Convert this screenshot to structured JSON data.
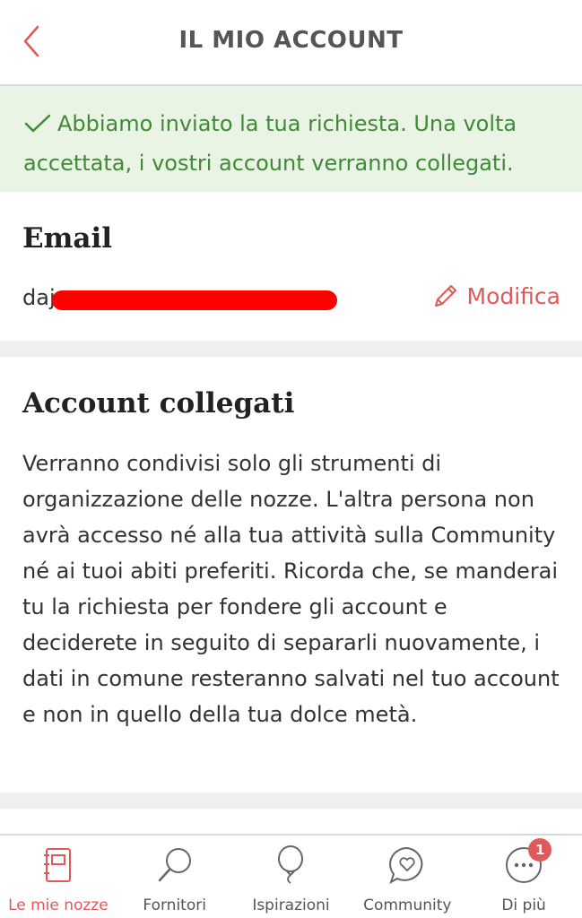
{
  "header": {
    "title": "IL MIO ACCOUNT",
    "back_icon": "chevron-left-icon"
  },
  "notice": {
    "text": "Abbiamo inviato la tua richiesta. Una volta accettata, i vostri account verranno collegati.",
    "icon": "check-icon",
    "color": "#3f8a35"
  },
  "email_section": {
    "title": "Email",
    "value_visible": "daj",
    "edit_label": "Modifica"
  },
  "linked_section": {
    "title": "Account collegati",
    "description": "Verranno condivisi solo gli strumenti di organizzazione delle nozze. L'altra persona non avrà accesso né alla tua attività sulla Community né ai tuoi abiti preferiti. Ricorda che, se manderai tu la richiesta per fondere gli account e deciderete in seguito di separarli nuovamente, i dati in comune resteranno salvati nel tuo account e non in quello della tua dolce metà."
  },
  "tabbar": {
    "tabs": [
      {
        "label": "Le mie nozze",
        "icon": "notebook-icon",
        "active": true
      },
      {
        "label": "Fornitori",
        "icon": "search-icon",
        "active": false
      },
      {
        "label": "Ispirazioni",
        "icon": "balloon-icon",
        "active": false
      },
      {
        "label": "Community",
        "icon": "chat-heart-icon",
        "active": false
      },
      {
        "label": "Di più",
        "icon": "more-icon",
        "active": false,
        "badge": "1"
      }
    ]
  },
  "colors": {
    "accent": "#e0595a",
    "success_bg": "#e9f4e5",
    "success_text": "#3f8a35"
  }
}
